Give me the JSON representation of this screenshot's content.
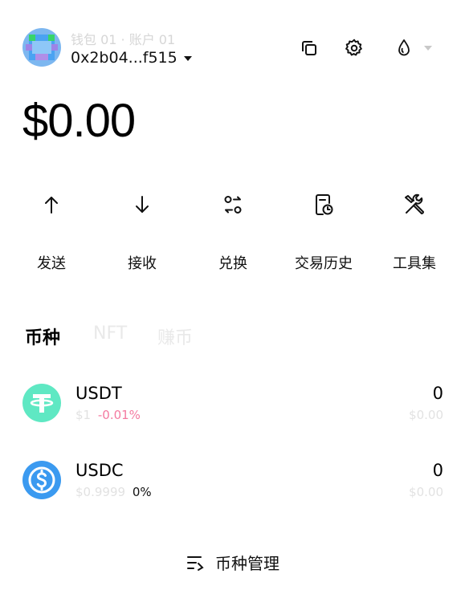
{
  "header": {
    "wallet_account": "钱包 01 · 账户 01",
    "address": "0x2b04...f515",
    "icons": [
      "copy-icon",
      "gear-icon",
      "network-drop-icon"
    ]
  },
  "balance": "$0.00",
  "actions": [
    {
      "label": "发送",
      "icon": "arrow-up-icon"
    },
    {
      "label": "接收",
      "icon": "arrow-down-icon"
    },
    {
      "label": "兑换",
      "icon": "swap-icon"
    },
    {
      "label": "交易历史",
      "icon": "history-icon"
    },
    {
      "label": "工具集",
      "icon": "tools-icon"
    }
  ],
  "tabs": [
    "币种",
    "NFT",
    "赚币"
  ],
  "tokens": [
    {
      "symbol": "USDT",
      "price": "$1",
      "change": "-0.01%",
      "amount": "0",
      "value": "$0.00",
      "color": "#5fe8c3",
      "change_color": "#f47aa0"
    },
    {
      "symbol": "USDC",
      "price": "$0.9999",
      "change": "0%",
      "amount": "0",
      "value": "$0.00",
      "color": "#3b9af0",
      "change_color": "#111111"
    }
  ],
  "manage_label": "币种管理"
}
